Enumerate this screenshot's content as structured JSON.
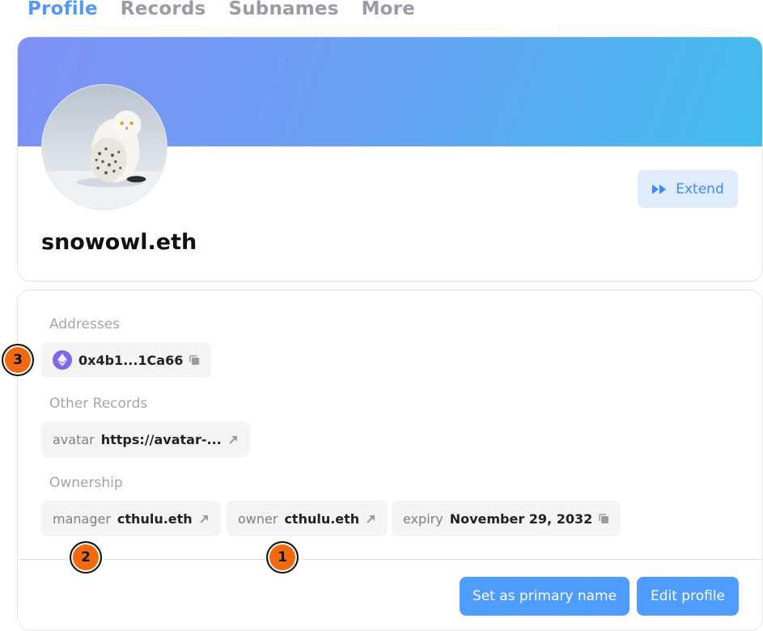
{
  "tabs": [
    {
      "label": "Profile",
      "active": true
    },
    {
      "label": "Records",
      "active": false
    },
    {
      "label": "Subnames",
      "active": false
    },
    {
      "label": "More",
      "active": false
    }
  ],
  "profile": {
    "name": "snowowl.eth",
    "extend_label": "Extend",
    "avatar_alt": "snowy owl avatar"
  },
  "records": {
    "addresses_label": "Addresses",
    "address": {
      "coin_icon": "ethereum-icon",
      "value": "0x4b1...1Ca66",
      "action_icon": "copy-icon"
    },
    "other_records_label": "Other Records",
    "other_records": [
      {
        "key": "avatar",
        "value": "https://avatar-...",
        "action_icon": "external-link-icon"
      }
    ],
    "ownership_label": "Ownership",
    "ownership": [
      {
        "key": "manager",
        "value": "cthulu.eth",
        "action_icon": "external-link-icon"
      },
      {
        "key": "owner",
        "value": "cthulu.eth",
        "action_icon": "external-link-icon"
      },
      {
        "key": "expiry",
        "value": "November 29, 2032",
        "action_icon": "copy-icon"
      }
    ]
  },
  "actions": {
    "set_primary_label": "Set as primary name",
    "edit_profile_label": "Edit profile"
  },
  "markers": [
    "1",
    "2",
    "3"
  ],
  "colors": {
    "accent": "#5298ff",
    "button": "#4e9cff",
    "extend_bg": "#e0ecfd",
    "marker": "#f26a10",
    "banner_start": "#7f91f5",
    "banner_end": "#43bdee"
  }
}
